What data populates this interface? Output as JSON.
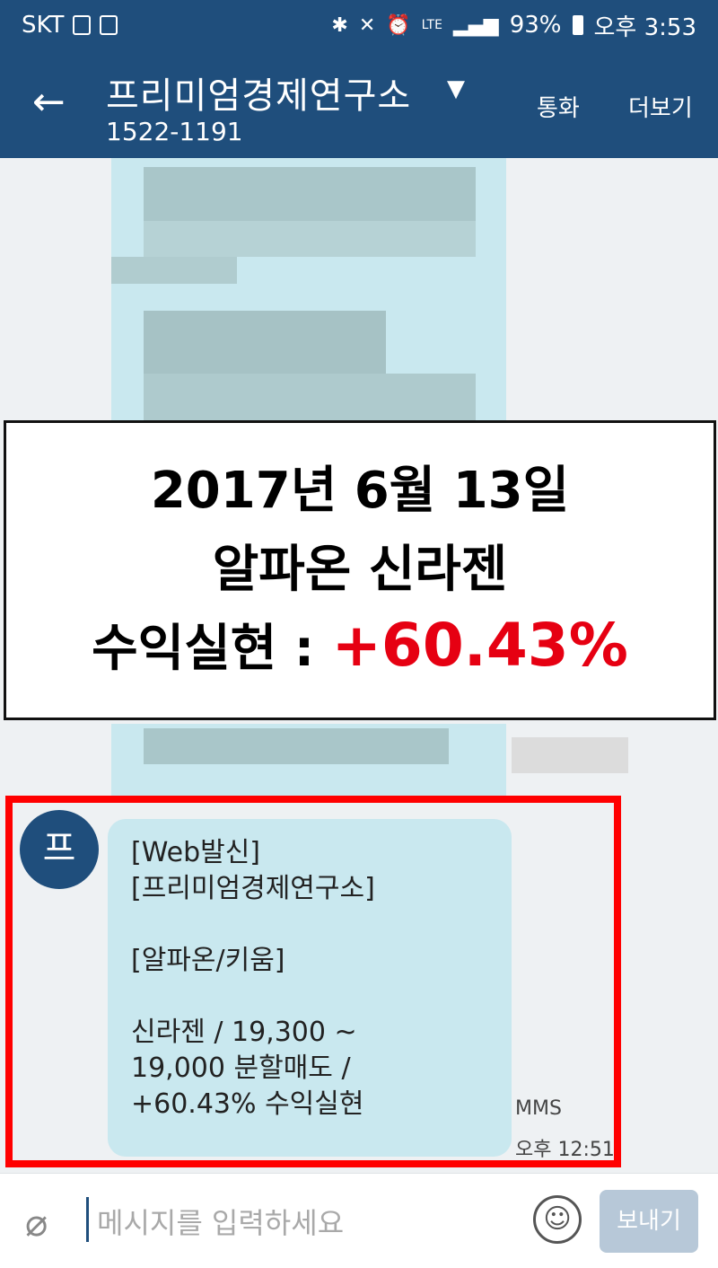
{
  "status_bar": {
    "carrier": "SKT",
    "battery": "93%",
    "time": "오후 3:53",
    "lte": "LTE"
  },
  "app_bar": {
    "title": "프리미엄경제연구소",
    "phone": "1522-1191",
    "call_label": "통화",
    "more_label": "더보기",
    "accent": "#1f4e7c"
  },
  "overlay": {
    "line1": "2017년 6월 13일",
    "line2": "알파온 신라젠",
    "line3_label": "수익실현 : ",
    "line3_value": "+60.43%",
    "value_color": "#e60012"
  },
  "message": {
    "avatar_letter": "프",
    "lines": [
      "[Web발신]",
      "[프리미엄경제연구소]",
      "",
      "[알파온/키움]",
      "",
      "신라젠 / 19,300 ~",
      "19,000 분할매도 /",
      "+60.43% 수익실현"
    ],
    "type": "MMS",
    "time": "오후 12:51",
    "bubble_color": "#c9e8ef",
    "highlight_color": "#ff0000"
  },
  "input": {
    "placeholder": "메시지를 입력하세요",
    "send_label": "보내기"
  }
}
